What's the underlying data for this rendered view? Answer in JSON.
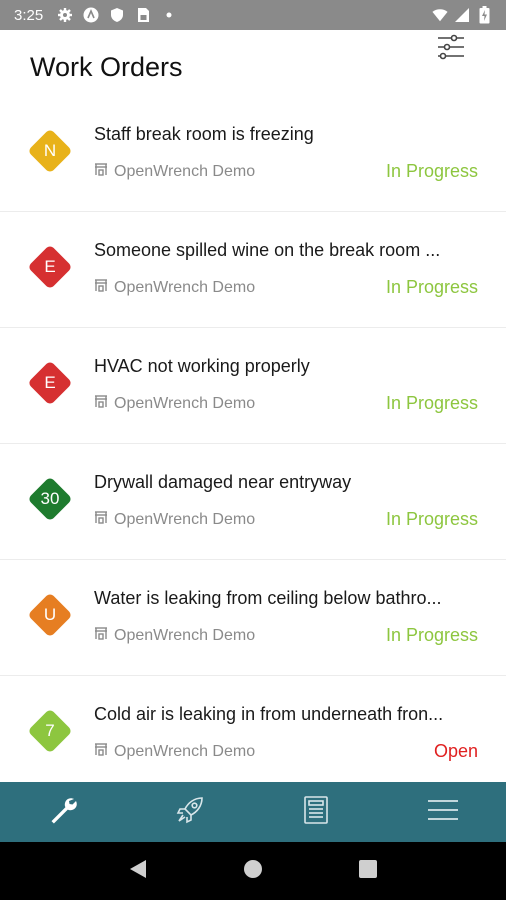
{
  "status_bar": {
    "time": "3:25",
    "icons": [
      "gear-icon",
      "app-icon",
      "shield-icon",
      "sim-card-icon",
      "dot-icon",
      "wifi-icon",
      "signal-icon",
      "battery-icon"
    ]
  },
  "header": {
    "title": "Work Orders",
    "filter_icon": "sliders-icon"
  },
  "work_orders": [
    {
      "priority": "N",
      "priority_color": "#e8b21a",
      "title": "Staff break room is freezing",
      "location": "OpenWrench Demo",
      "status": "In Progress",
      "status_color": "#8dc63f"
    },
    {
      "priority": "E",
      "priority_color": "#d63031",
      "title": "Someone spilled wine on the break room ...",
      "location": "OpenWrench Demo",
      "status": "In Progress",
      "status_color": "#8dc63f"
    },
    {
      "priority": "E",
      "priority_color": "#d63031",
      "title": "HVAC not working properly",
      "location": "OpenWrench Demo",
      "status": "In Progress",
      "status_color": "#8dc63f"
    },
    {
      "priority": "30",
      "priority_color": "#1e7b2e",
      "title": "Drywall damaged near entryway",
      "location": "OpenWrench Demo",
      "status": "In Progress",
      "status_color": "#8dc63f"
    },
    {
      "priority": "U",
      "priority_color": "#e67e22",
      "title": "Water is leaking from ceiling below bathro...",
      "location": "OpenWrench Demo",
      "status": "In Progress",
      "status_color": "#8dc63f"
    },
    {
      "priority": "7",
      "priority_color": "#8dc63f",
      "title": "Cold air is leaking in from underneath fron...",
      "location": "OpenWrench Demo",
      "status": "Open",
      "status_color": "#e02020"
    }
  ],
  "bottom_nav": {
    "background": "#2e6f7d",
    "items": [
      "wrench-icon",
      "rocket-icon",
      "report-icon",
      "menu-icon"
    ]
  },
  "system_nav": [
    "back-icon",
    "home-icon",
    "recents-icon"
  ]
}
